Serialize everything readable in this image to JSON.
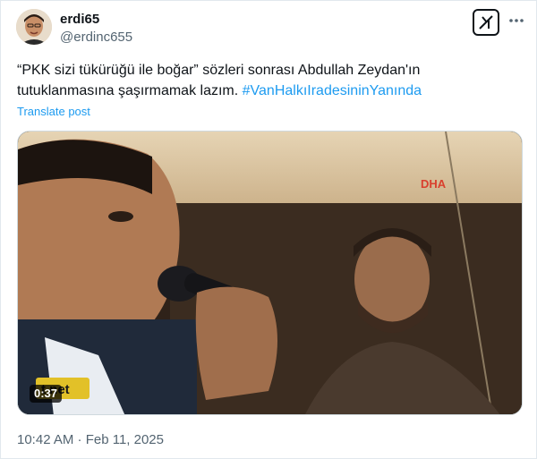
{
  "author": {
    "name": "erdi65",
    "handle": "@erdinc655"
  },
  "tweet": {
    "text": "“PKK sizi tükürüğü ile boğar” sözleri sonrası Abdullah Zeydan'ın tutuklanmasına şaşırmamak lazım. ",
    "hashtag": "#VanHalkıIradesininYanında",
    "translate_label": "Translate post",
    "timestamp": "10:42 AM · Feb 11, 2025"
  },
  "media": {
    "duration": "0:37",
    "watermark_top": "DHA",
    "watermark_bottom": "t net"
  },
  "icons": {
    "grok": "grok-icon",
    "more": "more-dots-icon"
  },
  "colors": {
    "link": "#1d9bf0",
    "secondary_text": "#536471",
    "primary_text": "#0f1419"
  }
}
